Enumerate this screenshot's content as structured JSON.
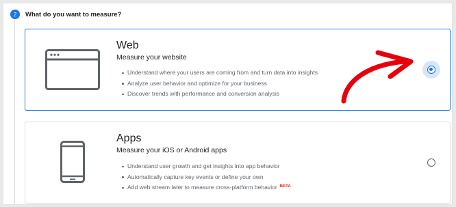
{
  "step": {
    "number": "2",
    "title": "What do you want to measure?"
  },
  "options": [
    {
      "id": "web",
      "icon": "browser-window-icon",
      "title": "Web",
      "subtitle": "Measure your website",
      "bullets": [
        "Understand where your users are coming from and turn data into insights",
        "Analyze user behavior and optimize for your business",
        "Discover trends with performance and conversion analysis"
      ],
      "selected": true
    },
    {
      "id": "apps",
      "icon": "smartphone-icon",
      "title": "Apps",
      "subtitle": "Measure your iOS or Android apps",
      "bullets": [
        "Understand user growth and get insights into app behavior",
        "Automatically capture key events or define your own",
        "Add web stream later to measure cross-platform behavior"
      ],
      "beta_label": "BETA",
      "selected": false
    }
  ],
  "annotation": {
    "icon": "red-hand-drawn-arrow",
    "color": "#e8000a"
  },
  "colors": {
    "accent": "#1a73e8",
    "beta": "#d93025",
    "text": "#202124",
    "secondary_text": "#5f6368"
  }
}
